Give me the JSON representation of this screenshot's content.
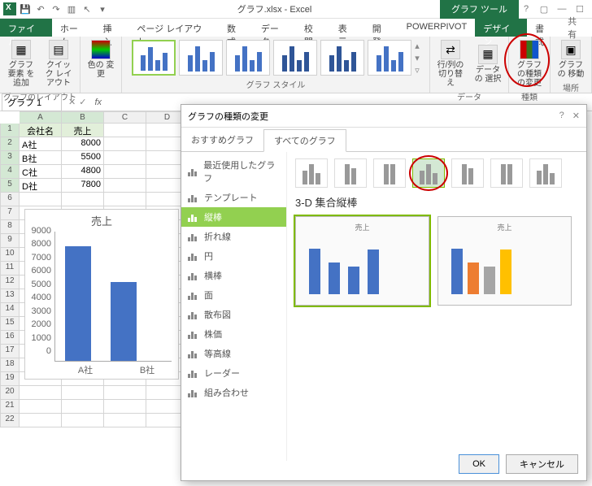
{
  "app": {
    "title": "グラフ.xlsx - Excel",
    "tool_title": "グラフ ツール"
  },
  "tabs": {
    "file": "ファイル",
    "home": "ホーム",
    "insert": "挿入",
    "pagelayout": "ページ レイアウト",
    "formulas": "数式",
    "data": "データ",
    "review": "校閲",
    "view": "表示",
    "dev": "開発",
    "powerpivot": "POWERPIVOT",
    "design": "デザイン",
    "format": "書式",
    "share": "共有"
  },
  "ribbon": {
    "add_element": "グラフ要素\nを追加",
    "quick_layout": "クイック\nレイアウト",
    "change_colors": "色の\n変更",
    "switch_rowcol": "行/列の\n切り替え",
    "select_data": "データの\n選択",
    "change_type": "グラフの種類\nの変更",
    "move_chart": "グラフの\n移動",
    "g_layout": "グラフのレイアウト",
    "g_styles": "グラフ スタイル",
    "g_data": "データ",
    "g_type": "種類",
    "g_loc": "場所"
  },
  "namebox": "グラフ 1",
  "sheet": {
    "cols": [
      "A",
      "B",
      "C",
      "D"
    ],
    "h_company": "会社名",
    "h_sales": "売上",
    "rows": [
      {
        "c": "A社",
        "v": "8000"
      },
      {
        "c": "B社",
        "v": "5500"
      },
      {
        "c": "C社",
        "v": "4800"
      },
      {
        "c": "D社",
        "v": "7800"
      }
    ]
  },
  "embedded_chart": {
    "title": "売上",
    "cats": [
      "A社",
      "B社"
    ],
    "yticks": [
      "9000",
      "8000",
      "7000",
      "6000",
      "5000",
      "4000",
      "3000",
      "2000",
      "1000",
      "0"
    ]
  },
  "dialog": {
    "title": "グラフの種類の変更",
    "tab_rec": "おすすめグラフ",
    "tab_all": "すべてのグラフ",
    "cats": [
      "最近使用したグラフ",
      "テンプレート",
      "縦棒",
      "折れ線",
      "円",
      "横棒",
      "面",
      "散布図",
      "株価",
      "等高線",
      "レーダー",
      "組み合わせ"
    ],
    "subhead": "3-D 集合縦棒",
    "preview_title": "売上",
    "ok": "OK",
    "cancel": "キャンセル"
  },
  "chart_data": {
    "type": "bar",
    "title": "売上",
    "categories": [
      "A社",
      "B社",
      "C社",
      "D社"
    ],
    "values": [
      8000,
      5500,
      4800,
      7800
    ],
    "ylim": [
      0,
      9000
    ],
    "xlabel": "",
    "ylabel": ""
  }
}
